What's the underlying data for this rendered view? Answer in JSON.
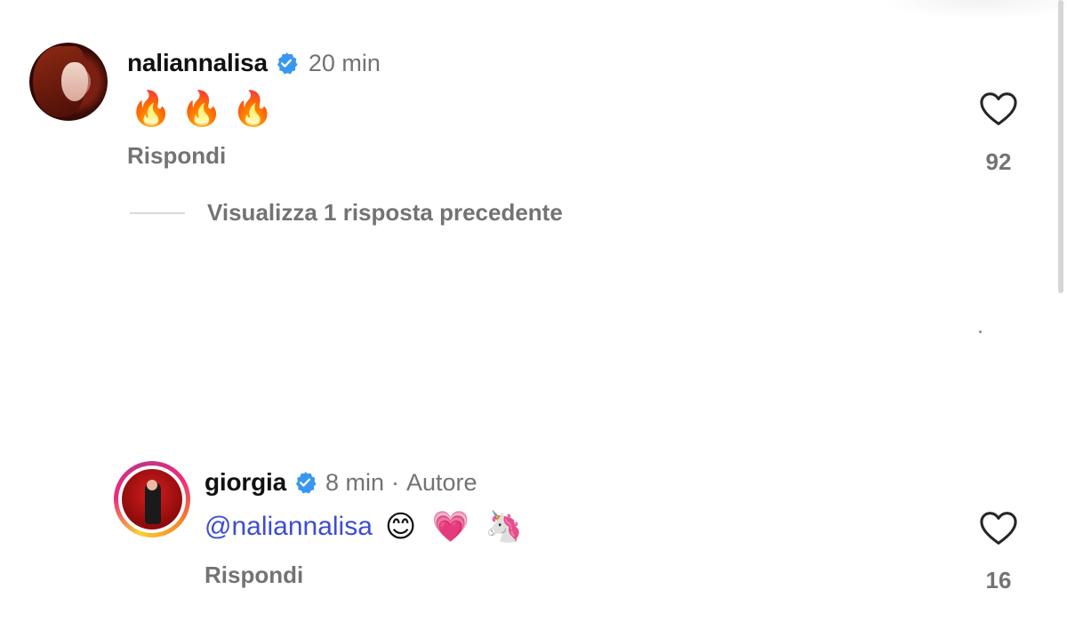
{
  "comments": [
    {
      "username": "naliannalisa",
      "verified": true,
      "time": "20 min",
      "text": "🔥🔥🔥",
      "reply_label": "Rispondi",
      "likes": "92",
      "avatar_icon": "profile-photo-red-hair"
    },
    {
      "username": "giorgia",
      "verified": true,
      "time": "8 min",
      "separator": "·",
      "author_label": "Autore",
      "mention": "@naliannalisa",
      "emojis": "😊 💗 🦄",
      "reply_label": "Rispondi",
      "likes": "16",
      "avatar_icon": "profile-photo-story-ring"
    }
  ],
  "thread": {
    "view_replies_label": "Visualizza 1 risposta precedente"
  },
  "colors": {
    "verified_blue": "#3897f0",
    "mention_blue": "#3d4dd3",
    "secondary_text": "#737373"
  }
}
